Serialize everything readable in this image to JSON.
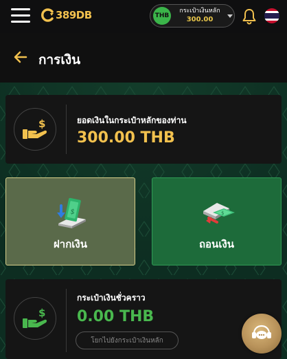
{
  "header": {
    "logo_text": "389DB",
    "wallet": {
      "currency_badge": "THB",
      "label": "กระเป๋าเงินหลัก",
      "amount": "300.00"
    }
  },
  "page": {
    "title": "การเงิน"
  },
  "balance_card": {
    "label": "ยอดเงินในกระเป๋าหลักของท่าน",
    "value": "300.00 THB"
  },
  "actions": {
    "deposit_label": "ฝากเงิน",
    "withdraw_label": "ถอนเงิน"
  },
  "temp_wallet": {
    "label": "กระเป๋าเงินชั่วคราว",
    "value": "0.00 THB",
    "transfer_button": "โยกไปยังกระเป๋าเงินหลัก"
  },
  "icons": {
    "menu": "hamburger-icon",
    "bell": "bell-icon",
    "flag": "thai-flag-icon",
    "back": "back-arrow-icon",
    "hand_money": "hand-money-icon",
    "deposit": "deposit-icon",
    "withdraw": "withdraw-icon",
    "chat": "chat-support-icon"
  },
  "colors": {
    "accent_gold": "#f2c14e",
    "accent_green": "#49b84e",
    "background_dark": "#151515",
    "deposit_card": "#5a6a4a",
    "withdraw_card": "#1d6b3a"
  }
}
